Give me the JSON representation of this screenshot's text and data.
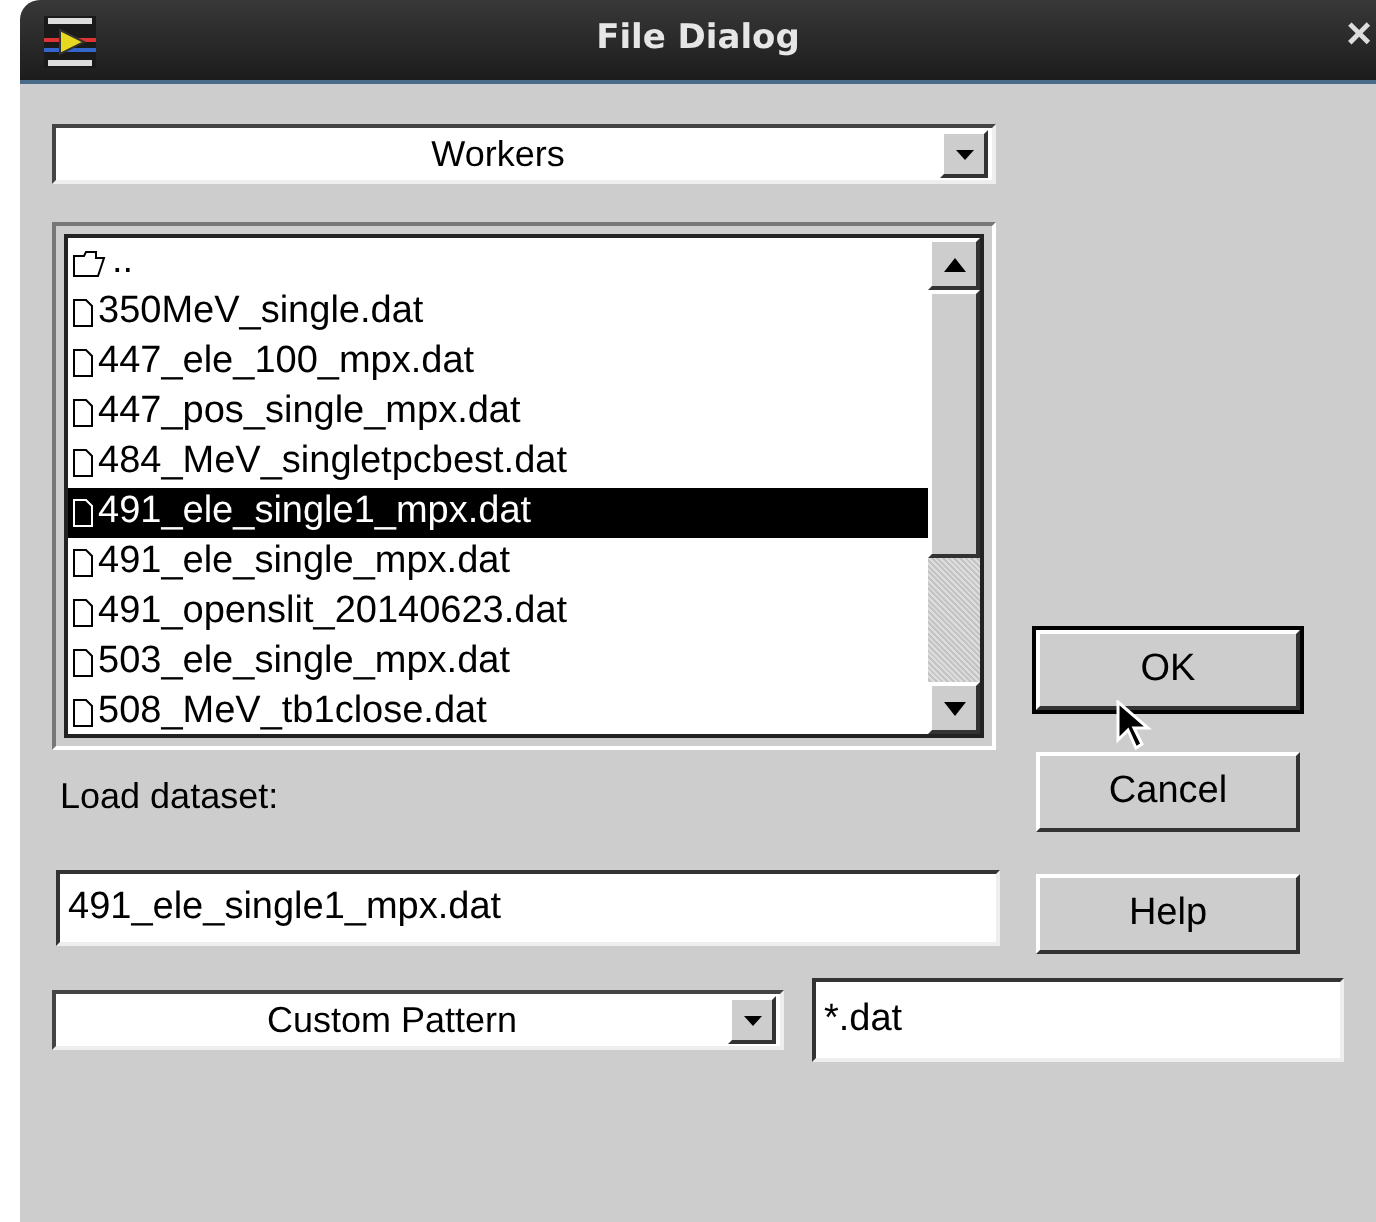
{
  "window": {
    "title": "File Dialog",
    "close": "×"
  },
  "directory": {
    "value": "Workers"
  },
  "files": [
    {
      "kind": "folder",
      "name": "..",
      "selected": false
    },
    {
      "kind": "file",
      "name": "350MeV_single.dat",
      "selected": false
    },
    {
      "kind": "file",
      "name": "447_ele_100_mpx.dat",
      "selected": false
    },
    {
      "kind": "file",
      "name": "447_pos_single_mpx.dat",
      "selected": false
    },
    {
      "kind": "file",
      "name": "484_MeV_singletpcbest.dat",
      "selected": false
    },
    {
      "kind": "file",
      "name": "491_ele_single1_mpx.dat",
      "selected": true
    },
    {
      "kind": "file",
      "name": "491_ele_single_mpx.dat",
      "selected": false
    },
    {
      "kind": "file",
      "name": "491_openslit_20140623.dat",
      "selected": false
    },
    {
      "kind": "file",
      "name": "503_ele_single_mpx.dat",
      "selected": false
    },
    {
      "kind": "file",
      "name": "508_MeV_tb1close.dat",
      "selected": false
    }
  ],
  "load_label": "Load dataset:",
  "filename": {
    "value": "491_ele_single1_mpx.dat"
  },
  "filter": {
    "value": "Custom Pattern"
  },
  "pattern": {
    "value": "*.dat"
  },
  "buttons": [
    {
      "label": "OK",
      "default": true
    },
    {
      "label": "Cancel",
      "default": false
    },
    {
      "label": "Help",
      "default": false
    }
  ]
}
